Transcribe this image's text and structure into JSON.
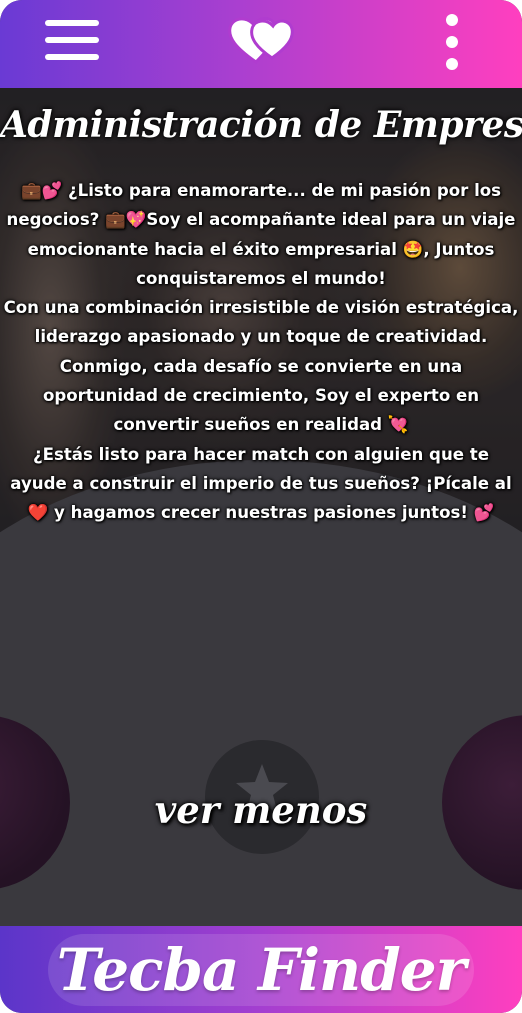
{
  "header": {
    "menu_icon": "hamburger-menu-icon",
    "logo_icon": "double-heart-icon",
    "more_icon": "vertical-dots-icon"
  },
  "profile": {
    "title": "Administración de Empresas",
    "bio_lines": [
      "💼💕 ¿Listo para enamorarte... de mi pasión por los negocios? 💼💖Soy el acompañante ideal para un viaje emocionante hacia el éxito empresarial 🤩, Juntos conquistaremos el mundo!",
      "Con una combinación irresistible de visión estratégica, liderazgo apasionado y un toque de creatividad. Conmigo, cada desafío se convierte en una oportunidad de crecimiento, Soy el experto en convertir sueños en realidad 💘",
      "¿Estás listo para hacer match con alguien que te ayude a construir el imperio de tus sueños? ¡Pícale al ❤️ y hagamos crecer nuestras pasiones juntos! 💕"
    ],
    "toggle_label": "ver menos",
    "star_icon": "star-icon"
  },
  "footer": {
    "brand": "Tecba Finder"
  },
  "colors": {
    "gradient_start": "#6a3ad4",
    "gradient_end": "#ff3fbf",
    "panel": "#3a393e"
  }
}
